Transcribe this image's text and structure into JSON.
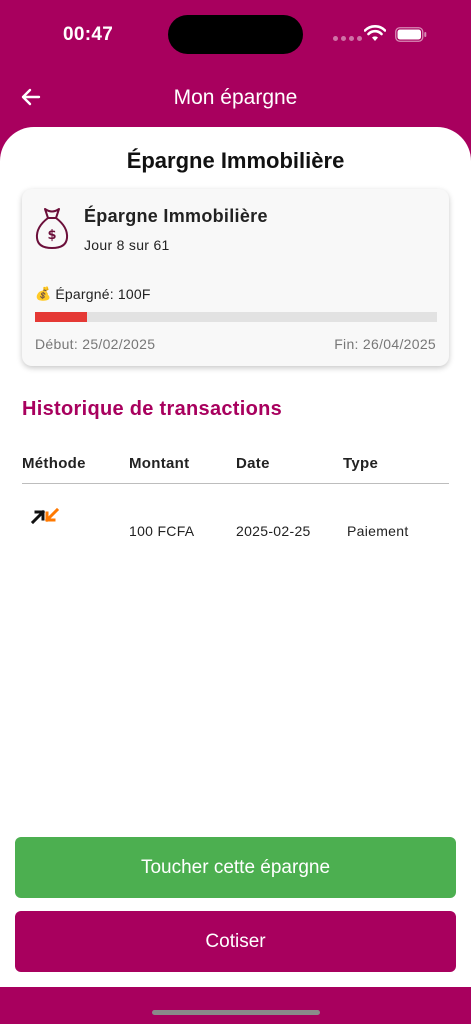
{
  "status_bar": {
    "time": "00:47"
  },
  "header": {
    "title": "Mon épargne"
  },
  "page": {
    "title": "Épargne Immobilière"
  },
  "card": {
    "title": "Épargne Immobilière",
    "day_text": "Jour 8 sur 61",
    "saved_text": "Épargné: 100F",
    "progress_fraction": 0.13,
    "start_text": "Début: 25/02/2025",
    "end_text": "Fin: 26/04/2025"
  },
  "transactions": {
    "title": "Historique de transactions",
    "columns": [
      "Méthode",
      "Montant",
      "Date",
      "Type"
    ],
    "rows": [
      {
        "method_icon": "orange-money-arrows-icon",
        "amount": "100 FCFA",
        "date": "2025-02-25",
        "type": "Paiement"
      }
    ]
  },
  "buttons": {
    "withdraw": "Toucher cette épargne",
    "contribute": "Cotiser"
  },
  "colors": {
    "brand": "#A8005E",
    "green": "#4CAF50",
    "progress": "#E53935"
  }
}
